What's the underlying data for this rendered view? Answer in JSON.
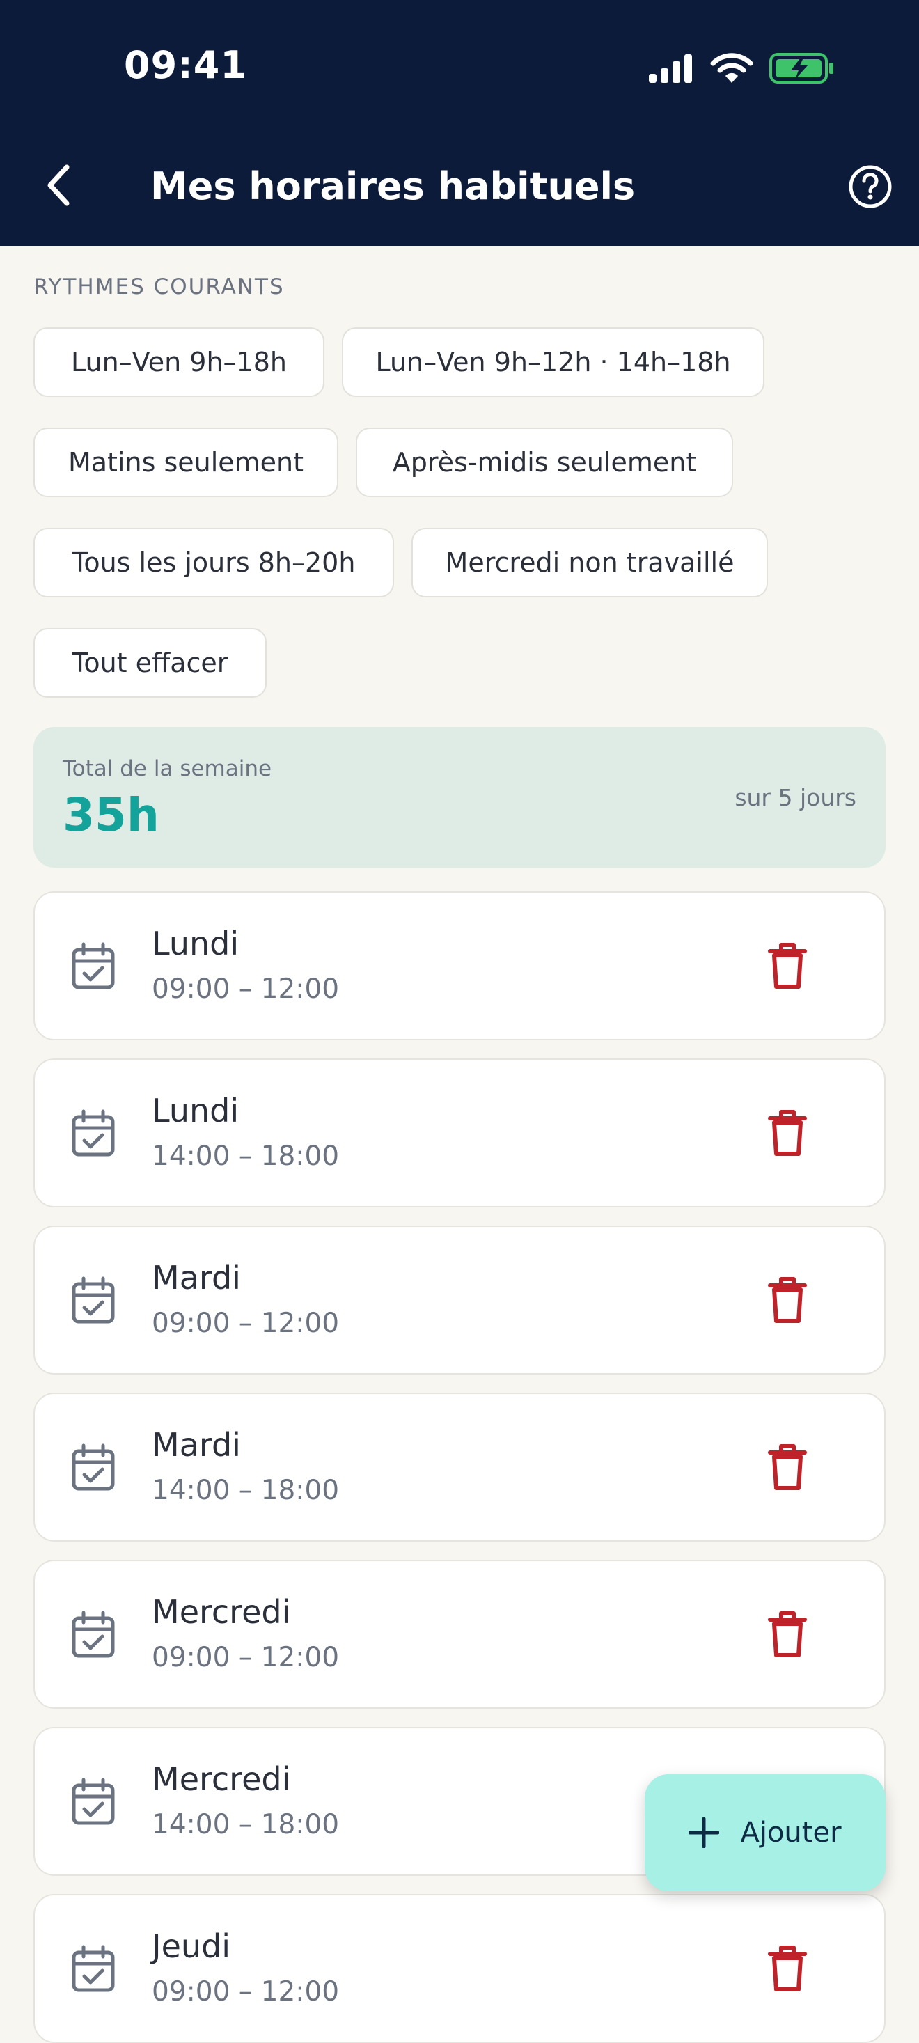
{
  "status_bar": {
    "time": "09:41"
  },
  "header": {
    "title": "Mes horaires habituels"
  },
  "presets": {
    "label": "RYTHMES COURANTS",
    "items": [
      "Lun–Ven 9h–18h",
      "Lun–Ven 9h–12h · 14h–18h",
      "Matins seulement",
      "Après-midis seulement",
      "Tous les jours 8h–20h",
      "Mercredi non travaillé",
      "Tout effacer"
    ]
  },
  "summary": {
    "label": "Total de la semaine",
    "total": "35h",
    "days": "sur 5 jours"
  },
  "slots": [
    {
      "day": "Lundi",
      "time": "09:00 – 12:00"
    },
    {
      "day": "Lundi",
      "time": "14:00 – 18:00"
    },
    {
      "day": "Mardi",
      "time": "09:00 – 12:00"
    },
    {
      "day": "Mardi",
      "time": "14:00 – 18:00"
    },
    {
      "day": "Mercredi",
      "time": "09:00 – 12:00"
    },
    {
      "day": "Mercredi",
      "time": "14:00 – 18:00"
    },
    {
      "day": "Jeudi",
      "time": "09:00 – 12:00"
    }
  ],
  "fab": {
    "label": "Ajouter"
  },
  "colors": {
    "header_bg": "#0d1b3a",
    "accent": "#14a39b",
    "delete": "#c0222a",
    "fab_bg": "#a7f0e6",
    "battery": "#3ec36b"
  },
  "icons": {
    "back": "chevron-left-icon",
    "help": "help-circle-icon",
    "calendar": "calendar-check-icon",
    "delete": "trash-icon",
    "add": "plus-icon"
  }
}
